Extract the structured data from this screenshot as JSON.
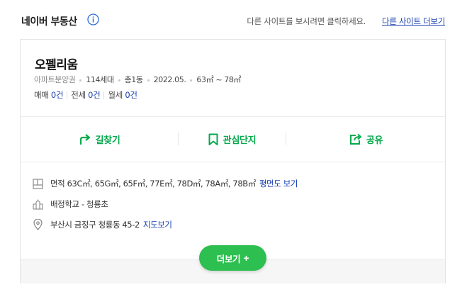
{
  "header": {
    "brand": "네이버 부동산",
    "hint": "다른 사이트를 보시려면 클릭하세요.",
    "more_site_link": "다른 사이트 더보기"
  },
  "complex": {
    "name": "오펠리움",
    "type": "아파트분양권",
    "households": "114세대",
    "buildings": "총1동",
    "date": "2022.05.",
    "area_range": "63㎡ ~ 78㎡"
  },
  "trades": {
    "sale_label": "매매",
    "sale_count": "0건",
    "jeonse_label": "전세",
    "jeonse_count": "0건",
    "monthly_label": "월세",
    "monthly_count": "0건"
  },
  "actions": {
    "directions": "길찾기",
    "favorite": "관심단지",
    "share": "공유"
  },
  "details": {
    "area_text": "면적 63C㎡, 65G㎡, 65F㎡, 77E㎡, 78D㎡, 78A㎡, 78B㎡",
    "floorplan_link": "평면도 보기",
    "school_text": "배정학교 - 청룡초",
    "address_text": "부산시 금정구 청룡동 45-2",
    "map_link": "지도보기"
  },
  "more_button": {
    "label": "더보기",
    "plus": "+"
  },
  "colors": {
    "accent_green": "#03a94c",
    "button_green": "#2dbf4f",
    "link_blue": "#1a3fb0"
  },
  "icons": [
    "info-icon",
    "directions-arrow-icon",
    "bookmark-icon",
    "share-icon",
    "floorplan-icon",
    "school-icon",
    "location-pin-icon"
  ]
}
